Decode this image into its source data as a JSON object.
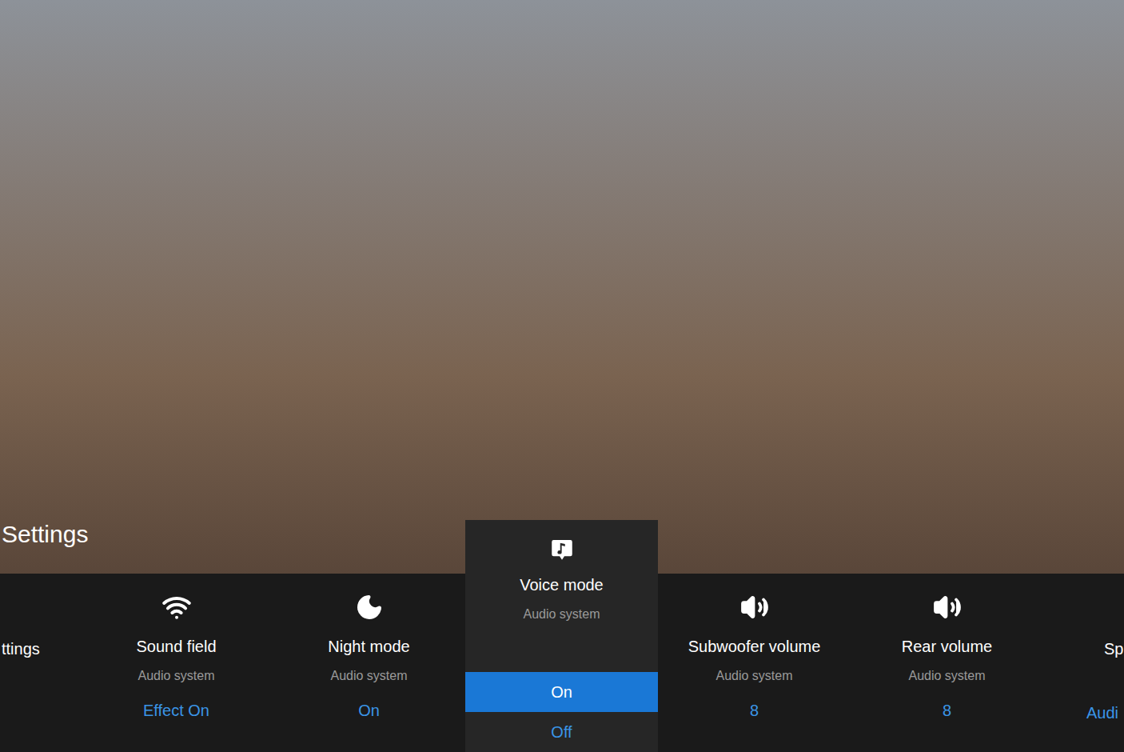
{
  "title": "Settings",
  "settings": [
    {
      "kind": "partial-left",
      "name": "ttings",
      "selected": false
    },
    {
      "kind": "card",
      "name": "Sound field",
      "category": "Audio system",
      "value": "Effect On",
      "selected": false
    },
    {
      "kind": "card",
      "name": "Night mode",
      "category": "Audio system",
      "value": "On",
      "selected": false
    },
    {
      "kind": "open-card",
      "name": "Voice mode",
      "category": "Audio system",
      "selected": true,
      "options": [
        {
          "label": "On",
          "selected": true
        },
        {
          "label": "Off",
          "selected": false
        }
      ]
    },
    {
      "kind": "card",
      "name": "Subwoofer volume",
      "category": "Audio system",
      "value": "8",
      "selected": false
    },
    {
      "kind": "card",
      "name": "Rear volume",
      "category": "Audio system",
      "value": "8",
      "selected": false
    },
    {
      "kind": "partial-right",
      "name": "Sp",
      "value": "Audi",
      "selected": false
    }
  ]
}
